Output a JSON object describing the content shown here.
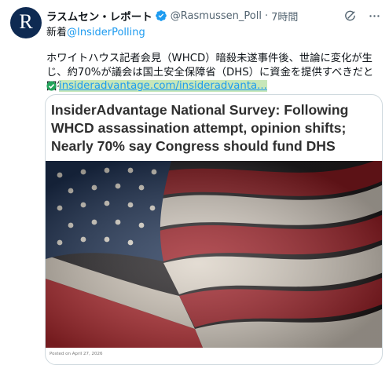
{
  "author": {
    "name": "ラスムセン・レポート",
    "handle": "@Rasmussen_Poll",
    "separator": "·",
    "time": "7時間",
    "avatar_letter": "R",
    "avatar_color": "#0e2a52"
  },
  "subline": {
    "prefix": "新着",
    "mention": "@InsiderPolling"
  },
  "tweet": {
    "text": "ホワイトハウス記者会見（WHCD）暗殺未遂事件後、世論に変化が生じ、約70%が議会は国土安全保障省（DHS）に資金を提供すべきだと回答した。",
    "link": "insideradvantage.com/insideradvanta..."
  },
  "card": {
    "title": "InsiderAdvantage National Survey: Following WHCD assassination attempt, opinion shifts; Nearly 70% say Congress should fund DHS",
    "footer": "Posted on April 27, 2026",
    "image": "american-flag-photo"
  },
  "icons": {
    "verified": "verified-badge-icon",
    "grok": "grok-icon",
    "more": "more-options-icon",
    "link": "checkmark-link-icon"
  },
  "colors": {
    "accent": "#1d9bf0",
    "link_highlight": "#c7e7b9",
    "muted": "#536471"
  }
}
